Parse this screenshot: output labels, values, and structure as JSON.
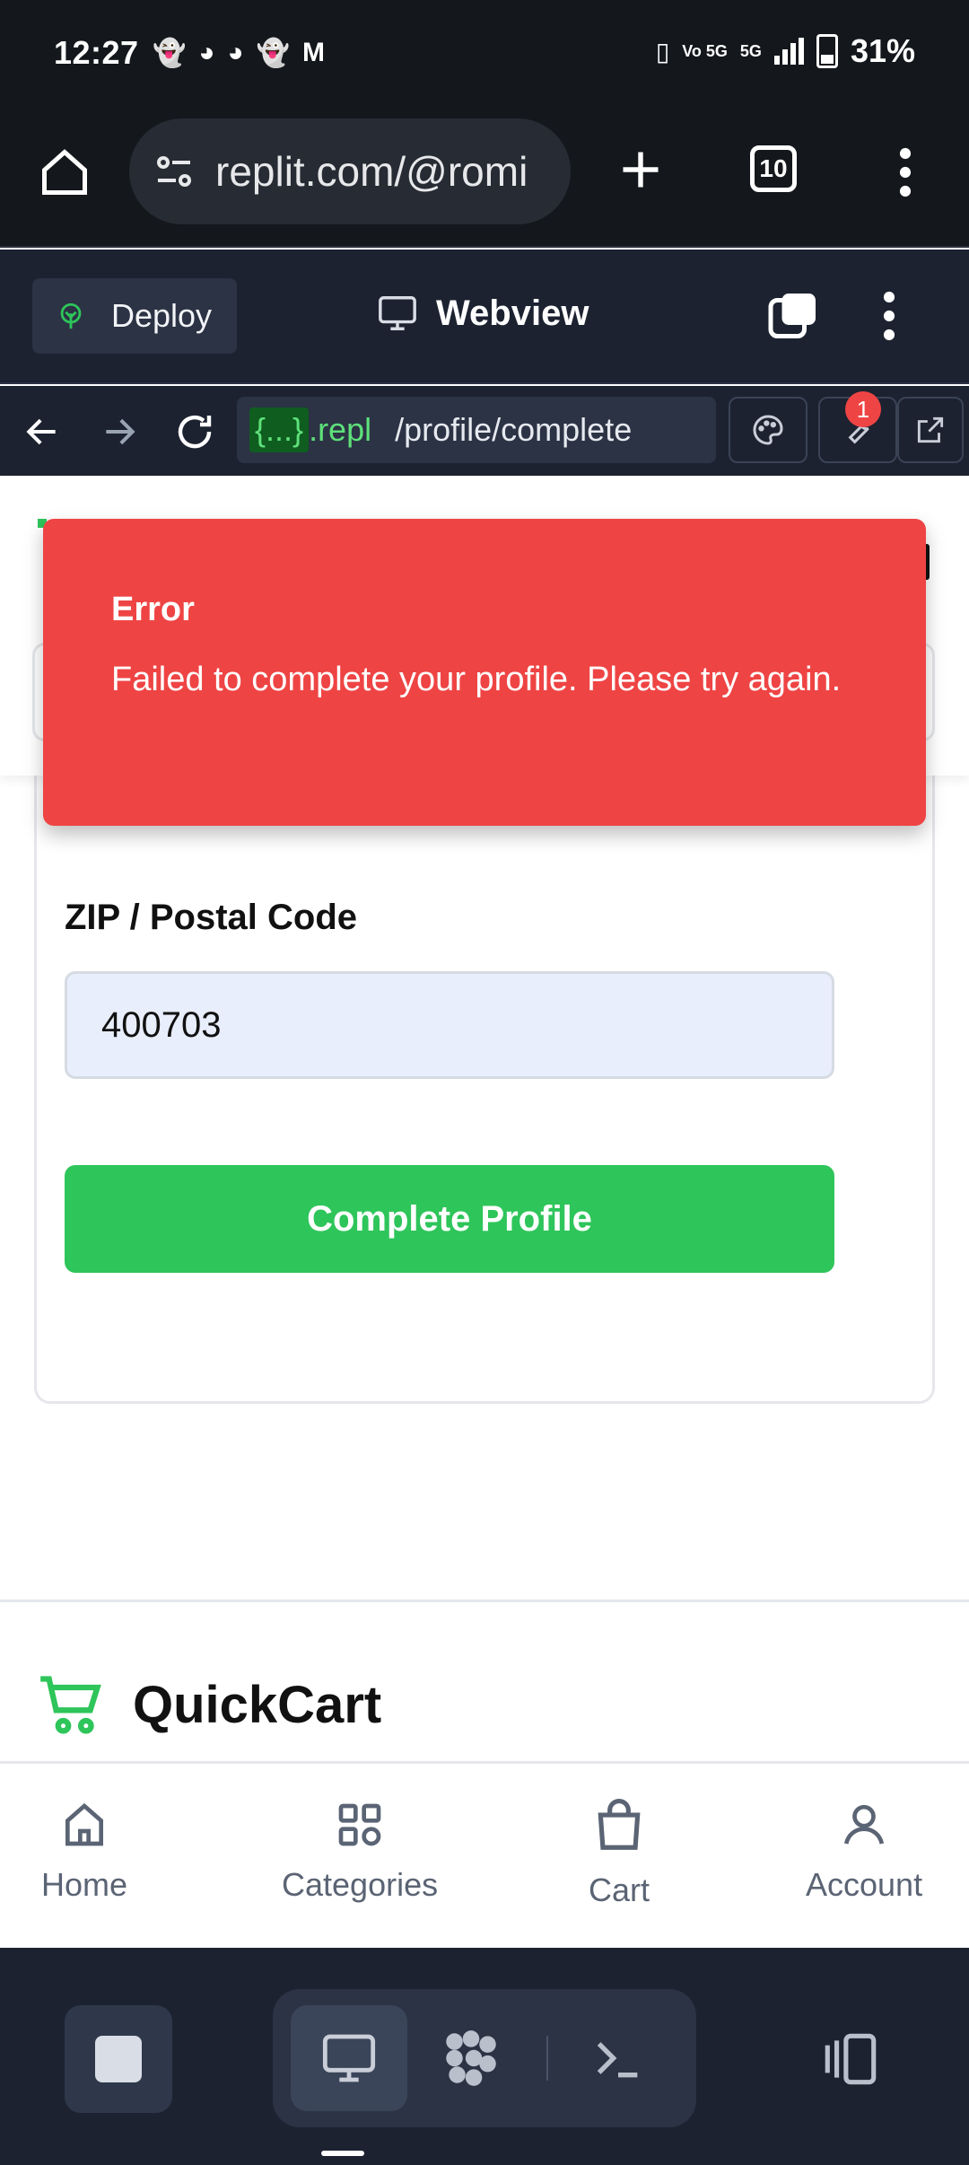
{
  "status_bar": {
    "time": "12:27",
    "battery": "31%",
    "network": "5G",
    "volte": "Vo 5G",
    "notification_icons": [
      "snapchat-icon",
      "discord-icon",
      "discord-icon",
      "snapchat-icon",
      "gmail-icon"
    ]
  },
  "browser": {
    "url": "replit.com/@romi",
    "tab_count": "10"
  },
  "replit_header": {
    "deploy_label": "Deploy",
    "view_label": "Webview"
  },
  "webview_nav": {
    "url_id": "{...}",
    "url_domain": ".repl",
    "url_path": "/profile/complete",
    "tools_badge": "1"
  },
  "toast": {
    "title": "Error",
    "message": "Failed to complete your profile. Please try again."
  },
  "form": {
    "zip_label": "ZIP / Postal Code",
    "zip_value": "400703",
    "submit_label": "Complete Profile"
  },
  "footer": {
    "brand_name": "QuickCart"
  },
  "bottom_nav": {
    "items": [
      {
        "label": "Home",
        "icon": "home-icon"
      },
      {
        "label": "Categories",
        "icon": "grid-icon"
      },
      {
        "label": "Cart",
        "icon": "shopping-bag-icon"
      },
      {
        "label": "Account",
        "icon": "user-icon"
      }
    ]
  },
  "colors": {
    "accent_green": "#2ec55a",
    "error_red": "#ef4444",
    "replit_dark": "#1c2230",
    "browser_dark": "#14171c"
  }
}
